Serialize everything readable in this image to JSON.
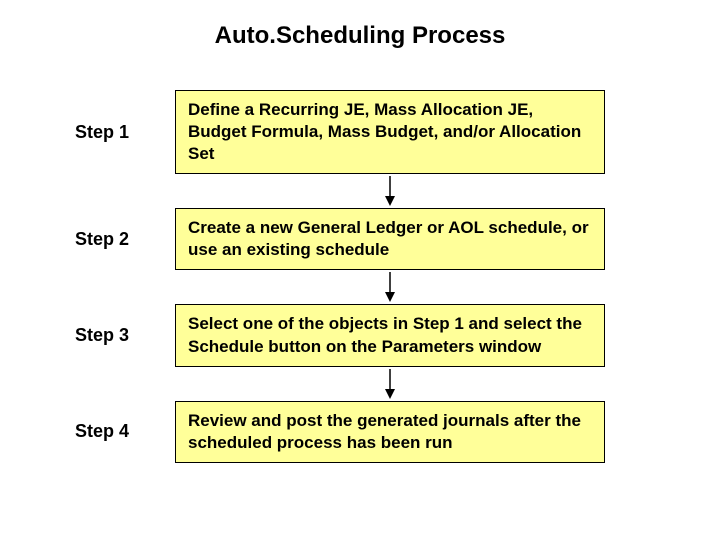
{
  "title": "Auto.Scheduling Process",
  "steps": [
    {
      "label": "Step 1",
      "text": "Define a Recurring JE, Mass Allocation JE, Budget Formula, Mass Budget, and/or Allocation Set"
    },
    {
      "label": "Step 2",
      "text": "Create a new General Ledger or AOL schedule, or use an existing schedule"
    },
    {
      "label": "Step 3",
      "text": "Select one of the objects in Step 1 and select the Schedule button on the Parameters window"
    },
    {
      "label": "Step 4",
      "text": "Review and post the generated journals after the scheduled process has been run"
    }
  ],
  "colors": {
    "box_bg": "#ffff99",
    "box_border": "#000000",
    "text": "#000000"
  }
}
